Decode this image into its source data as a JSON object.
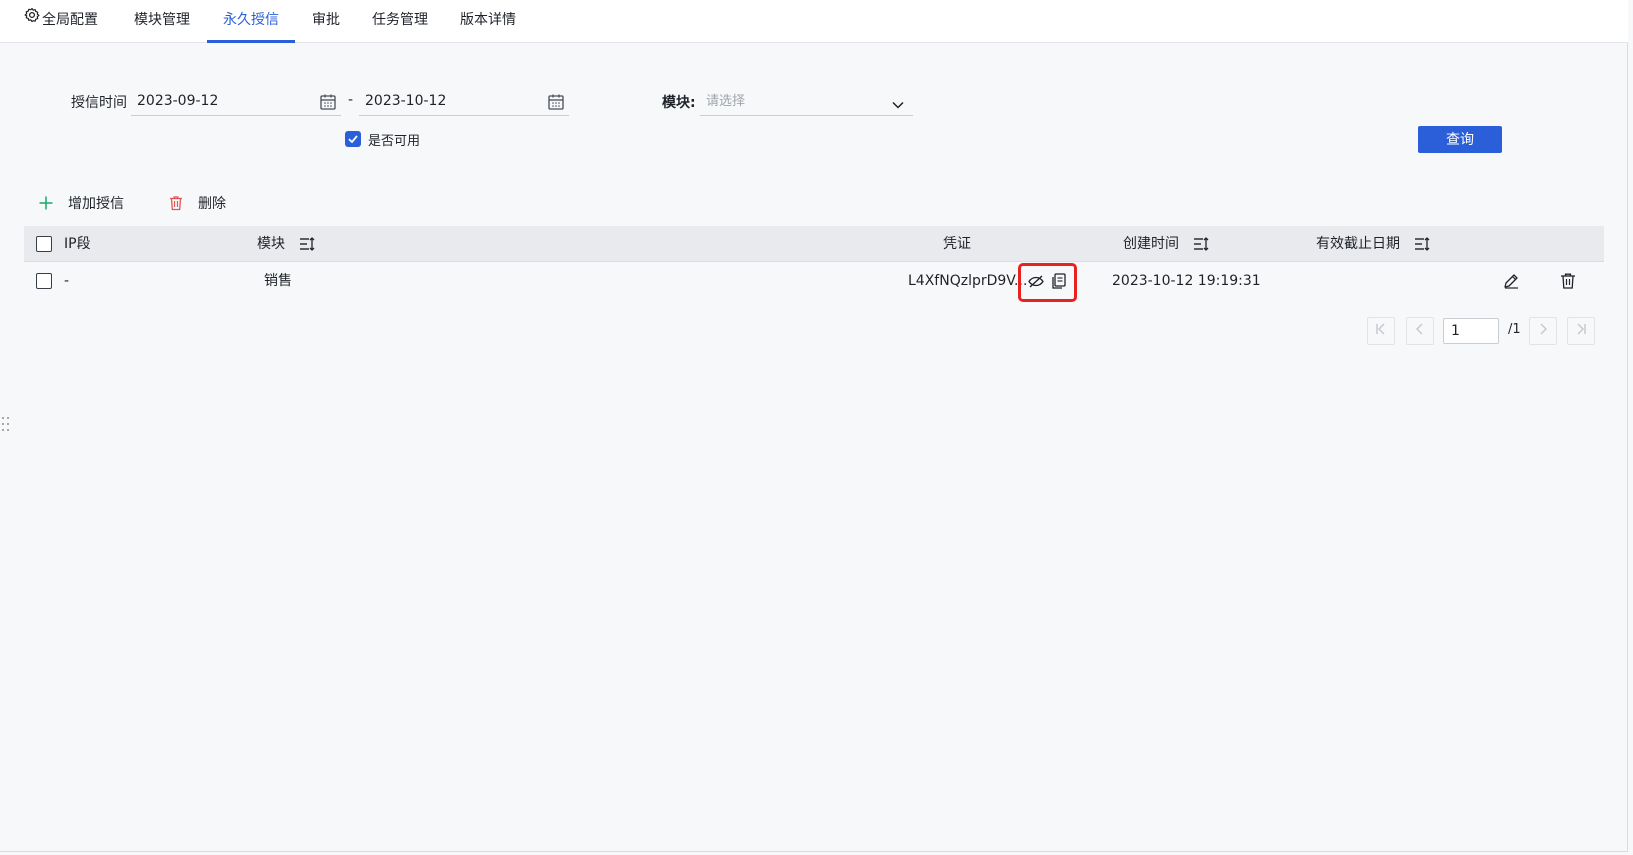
{
  "tabs": [
    {
      "label": "全局配置",
      "icon": "gear-icon"
    },
    {
      "label": "模块管理"
    },
    {
      "label": "永久授信",
      "active": true
    },
    {
      "label": "审批"
    },
    {
      "label": "任务管理"
    },
    {
      "label": "版本详情"
    }
  ],
  "filters": {
    "credit_time_label": "授信时间",
    "start_date": "2023-09-12",
    "separator": "-",
    "end_date": "2023-10-12",
    "module_label": "模块:",
    "module_placeholder": "请选择",
    "available_label": "是否可用",
    "available_checked": true,
    "query_button": "查询"
  },
  "toolbar": {
    "add_label": "增加授信",
    "delete_label": "删除"
  },
  "table": {
    "headers": {
      "ip": "IP段",
      "module": "模块",
      "credential": "凭证",
      "created": "创建时间",
      "expiry": "有效截止日期"
    },
    "rows": [
      {
        "ip": "-",
        "module": "销售",
        "credential": "L4XfNQzlprD9V...",
        "created": "2023-10-12 19:19:31",
        "expiry": ""
      }
    ]
  },
  "pagination": {
    "current_page": "1",
    "total": "/1"
  },
  "colors": {
    "accent": "#2b5fd9",
    "highlight": "#e8221f",
    "add_icon": "#1aa86b",
    "delete_icon": "#e05656"
  }
}
